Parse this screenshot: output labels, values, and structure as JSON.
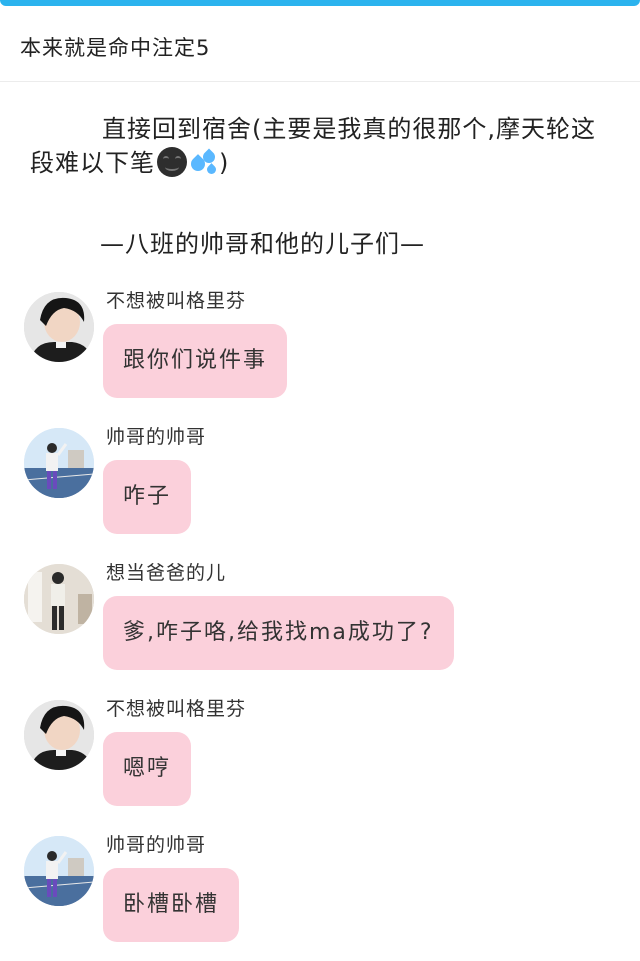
{
  "header": {
    "title": "本来就是命中注定5"
  },
  "intro": {
    "text": "直接回到宿舍(主要是我真的很那个,摩天轮这段难以下笔",
    "emojis": [
      "grimace-face-icon",
      "sweat-droplets-icon"
    ],
    "close": ")"
  },
  "section_title": "—八班的帅哥和他的儿子们—",
  "messages": [
    {
      "sender": "不想被叫格里芬",
      "text": "跟你们说件事",
      "avatar": "dark-hair-portrait"
    },
    {
      "sender": "帅哥的帅哥",
      "text": "咋子",
      "avatar": "playground-portrait"
    },
    {
      "sender": "想当爸爸的儿",
      "text": "爹,咋子咯,给我找ma成功了?",
      "avatar": "indoor-portrait"
    },
    {
      "sender": "不想被叫格里芬",
      "text": "嗯哼",
      "avatar": "dark-hair-portrait"
    },
    {
      "sender": "帅哥的帅哥",
      "text": "卧槽卧槽",
      "avatar": "playground-portrait"
    }
  ],
  "colors": {
    "accent": "#2bb3ee",
    "bubble": "#fbd0db"
  }
}
